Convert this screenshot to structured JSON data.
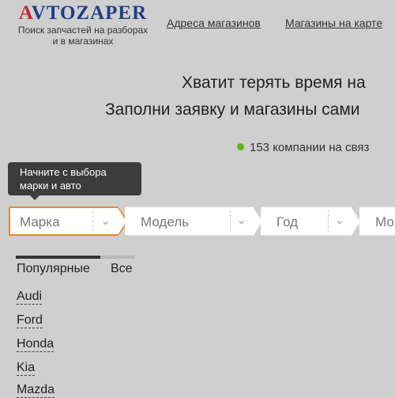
{
  "header": {
    "logo_first": "A",
    "logo_rest": "VTOZAPER",
    "tagline_line1": "Поиск запчастей на разборах",
    "tagline_line2": "и в магазинах",
    "nav": {
      "addresses": "Адреса магазинов",
      "map": "Магазины на карте"
    }
  },
  "hero": {
    "line1": "Хватит терять время на",
    "line2": "Заполни заявку и магазины сами",
    "online_text": "153 компании на связ",
    "online_color": "#5ab61c"
  },
  "tooltip": {
    "line1": "Начните с выбора",
    "line2": "марки и авто"
  },
  "selector": {
    "brand": "Марка",
    "model": "Модель",
    "year": "Год",
    "modification": "Мо",
    "chevron": "chevron-down-icon",
    "active_border_color": "#e98a2d"
  },
  "tabs": {
    "popular": "Популярные",
    "all": "Все"
  },
  "brands": [
    "Audi",
    "Ford",
    "Honda",
    "Kia",
    "Mazda"
  ]
}
